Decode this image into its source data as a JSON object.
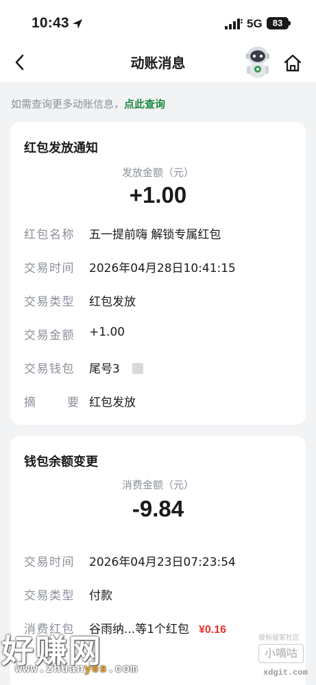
{
  "status_bar": {
    "time": "10:43",
    "network": "5G",
    "battery": "83"
  },
  "nav": {
    "title": "动账消息"
  },
  "hint": {
    "text": "如需查询更多动账信息，",
    "link": "点此查询"
  },
  "cards": [
    {
      "title": "红包发放通知",
      "amount_label": "发放金额（元）",
      "amount": "+1.00",
      "rows": [
        {
          "label": "红包名称",
          "value": "五一提前嗨 解锁专属红包"
        },
        {
          "label": "交易时间",
          "value": "2026年04月28日10:41:15"
        },
        {
          "label": "交易类型",
          "value": "红包发放"
        },
        {
          "label": "交易金额",
          "value": "+1.00"
        },
        {
          "label": "交易钱包",
          "value": "尾号3"
        },
        {
          "label_left": "摘",
          "label_right": "要",
          "value": "红包发放"
        }
      ]
    },
    {
      "title": "钱包余额变更",
      "amount_label": "消费金额（元）",
      "amount": "-9.84",
      "rows": [
        {
          "label": "交易时间",
          "value": "2026年04月23日07:23:54"
        },
        {
          "label": "交易类型",
          "value": "付款"
        },
        {
          "label": "消费红包",
          "value": "谷雨纳...等1个红包",
          "extra": "¥0.16"
        }
      ]
    }
  ],
  "watermarks": {
    "logo": "好赚网",
    "url_pre": "www.zhuan",
    "url_hl": "yes",
    "url_post": ".com",
    "small": "彼标留家社区",
    "box": "小嘀咕",
    "url2": "xdgit.com"
  },
  "colors": {
    "accent_green": "#1f8a3f",
    "red": "#e5312a",
    "background": "#f2f3f5"
  }
}
